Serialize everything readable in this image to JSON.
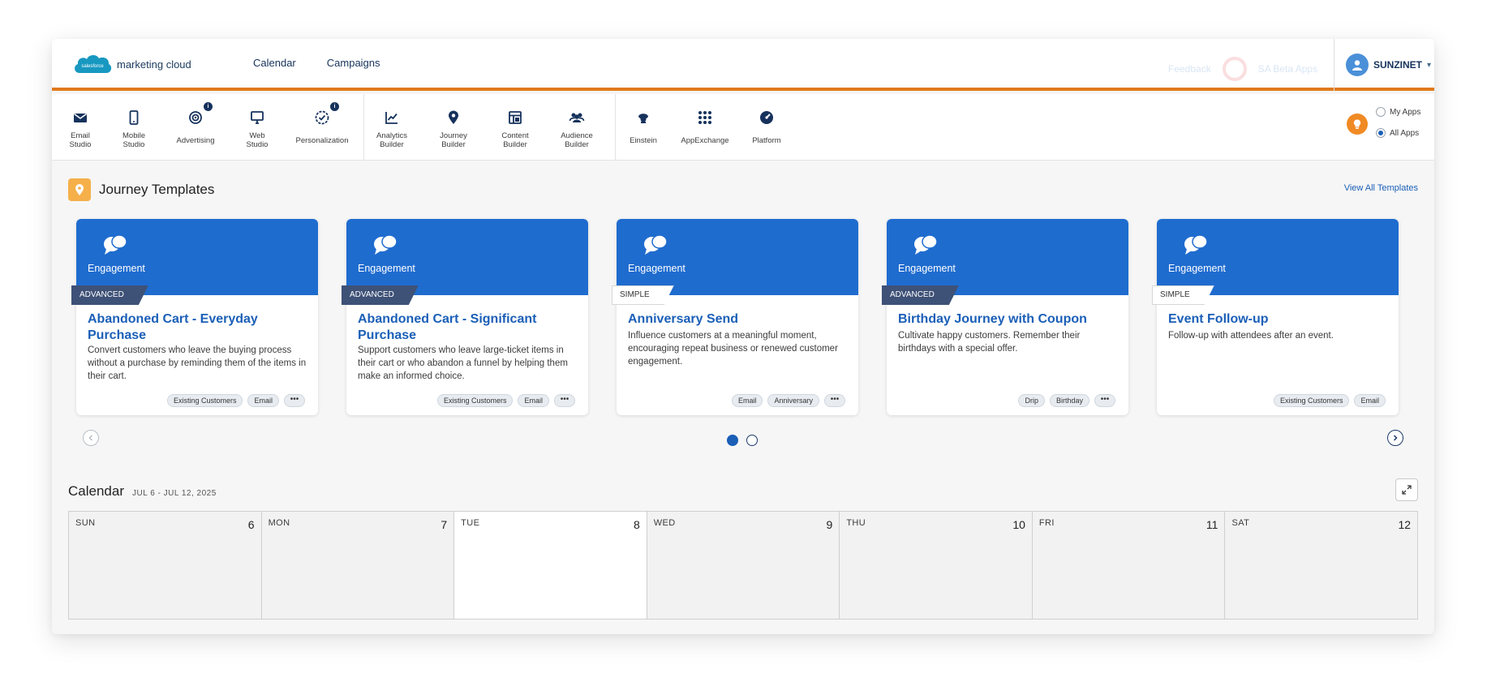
{
  "header": {
    "logo_badge": "salesforce",
    "logo_text": "marketing cloud",
    "nav": [
      "Calendar",
      "Campaigns"
    ],
    "faded_feedback": "Feedback",
    "faded_apps": "SA Beta Apps",
    "username": "SUNZINET"
  },
  "apps": [
    {
      "name": "email-studio",
      "label": "Email\nStudio",
      "icon": "envelope-icon"
    },
    {
      "name": "mobile-studio",
      "label": "Mobile\nStudio",
      "icon": "phone-icon"
    },
    {
      "name": "advertising",
      "label": "Advertising",
      "icon": "target-icon",
      "badge": "i"
    },
    {
      "name": "web-studio",
      "label": "Web\nStudio",
      "icon": "monitor-icon"
    },
    {
      "name": "personalization",
      "label": "Personalization",
      "icon": "shield-check-icon",
      "badge": "i"
    },
    {
      "name": "analytics-builder",
      "label": "Analytics\nBuilder",
      "icon": "line-chart-icon"
    },
    {
      "name": "journey-builder",
      "label": "Journey\nBuilder",
      "icon": "location-pin-icon"
    },
    {
      "name": "content-builder",
      "label": "Content\nBuilder",
      "icon": "layout-icon"
    },
    {
      "name": "audience-builder",
      "label": "Audience\nBuilder",
      "icon": "people-icon"
    },
    {
      "name": "einstein",
      "label": "Einstein",
      "icon": "einstein-icon"
    },
    {
      "name": "appexchange",
      "label": "AppExchange",
      "icon": "grid-icon"
    },
    {
      "name": "platform",
      "label": "Platform",
      "icon": "gauge-icon"
    }
  ],
  "app_filter": {
    "options": [
      "My Apps",
      "All Apps"
    ],
    "selected": "All Apps"
  },
  "journey_templates": {
    "title": "Journey Templates",
    "view_all": "View All Templates",
    "cards": [
      {
        "category": "Engagement",
        "level": "ADVANCED",
        "title": "Abandoned Cart - Everyday Purchase",
        "desc": "Convert customers who leave the buying process without a purchase by reminding them of the items in their cart.",
        "tags": [
          "Existing Customers",
          "Email"
        ],
        "more": true
      },
      {
        "category": "Engagement",
        "level": "ADVANCED",
        "title": "Abandoned Cart - Significant Purchase",
        "desc": "Support customers who leave large-ticket items in their cart or who abandon a funnel by helping them make an informed choice.",
        "tags": [
          "Existing Customers",
          "Email"
        ],
        "more": true
      },
      {
        "category": "Engagement",
        "level": "SIMPLE",
        "title": "Anniversary Send",
        "desc": "Influence customers at a meaningful moment, encouraging repeat business or renewed customer engagement.",
        "tags": [
          "Email",
          "Anniversary"
        ],
        "more": true
      },
      {
        "category": "Engagement",
        "level": "ADVANCED",
        "title": "Birthday Journey with Coupon",
        "desc": "Cultivate happy customers. Remember their birthdays with a special offer.",
        "tags": [
          "Drip",
          "Birthday"
        ],
        "more": true
      },
      {
        "category": "Engagement",
        "level": "SIMPLE",
        "title": "Event Follow-up",
        "desc": "Follow-up with attendees after an event.",
        "tags": [
          "Existing Customers",
          "Email"
        ],
        "more": false
      }
    ],
    "pages": 2,
    "current_page": 1
  },
  "calendar": {
    "title": "Calendar",
    "range": "JUL 6 - JUL 12, 2025",
    "days": [
      {
        "name": "SUN",
        "date": "6"
      },
      {
        "name": "MON",
        "date": "7"
      },
      {
        "name": "TUE",
        "date": "8",
        "today": true
      },
      {
        "name": "WED",
        "date": "9"
      },
      {
        "name": "THU",
        "date": "10"
      },
      {
        "name": "FRI",
        "date": "11"
      },
      {
        "name": "SAT",
        "date": "12"
      }
    ]
  },
  "colors": {
    "accent": "#e07a1c",
    "brand_blue": "#1f6ccf",
    "link": "#1b5fb7",
    "advanced_ribbon": "#3e5177"
  }
}
